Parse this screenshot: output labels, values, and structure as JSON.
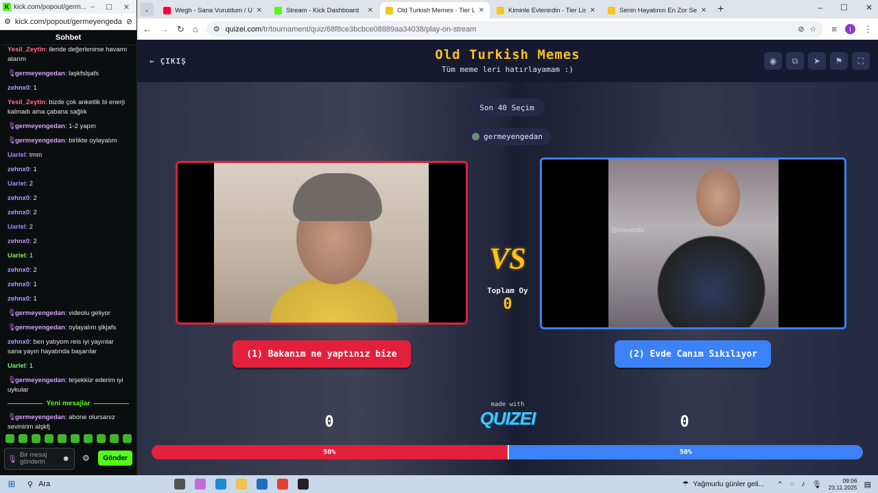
{
  "kick_popout": {
    "window_url_title": "kick.com/popout/germ...",
    "url": "kick.com/popout/germeyengedan...",
    "chat_title": "Sohbet",
    "messages": [
      {
        "user": "Yesil_Zeytin",
        "text": "ileride değerlenirse havamı atarım",
        "color": "yesil",
        "mic": false
      },
      {
        "user": "germeyengedan",
        "text": "laşkfslşafs",
        "color": "germ",
        "mic": true
      },
      {
        "user": "zehnx0",
        "text": "1",
        "color": "zeh",
        "mic": false
      },
      {
        "user": "Yesil_Zeytin",
        "text": "bizde çok anketlik bi enerji kalmadı ama çabana sağlık",
        "color": "yesil",
        "mic": false
      },
      {
        "user": "germeyengedan",
        "text": "1-2 yapın",
        "color": "germ",
        "mic": true
      },
      {
        "user": "germeyengedan",
        "text": "birlikte oylayalım",
        "color": "germ",
        "mic": true
      },
      {
        "user": "Uariel",
        "text": "tmm",
        "color": "uar",
        "mic": false
      },
      {
        "user": "zehnx0",
        "text": "1",
        "color": "zeh",
        "mic": false
      },
      {
        "user": "Uariel",
        "text": "2",
        "color": "uar",
        "mic": false
      },
      {
        "user": "zehnx0",
        "text": "2",
        "color": "zeh",
        "mic": false
      },
      {
        "user": "zehnx0",
        "text": "2",
        "color": "zeh",
        "mic": false
      },
      {
        "user": "Uariel",
        "text": "2",
        "color": "uar",
        "mic": false
      },
      {
        "user": "zehnx0",
        "text": "2",
        "color": "zeh",
        "mic": false
      },
      {
        "user": "Uariel",
        "text": "1",
        "color": "uar2",
        "mic": false
      },
      {
        "user": "zehnx0",
        "text": "2",
        "color": "zeh",
        "mic": false
      },
      {
        "user": "zehnx0",
        "text": "1",
        "color": "zeh",
        "mic": false
      },
      {
        "user": "zehnx0",
        "text": "1",
        "color": "zeh",
        "mic": false
      },
      {
        "user": "germeyengedan",
        "text": "videolu geliyor",
        "color": "germ",
        "mic": true
      },
      {
        "user": "germeyengedan",
        "text": "oylayalım şlkjafs",
        "color": "germ",
        "mic": true
      },
      {
        "user": "zehnx0",
        "text": "ben yatıyom reis iyi yayınlar sana yayın hayatında başarılar",
        "color": "zeh",
        "mic": false
      },
      {
        "user": "Uariel",
        "text": "1",
        "color": "uar2",
        "mic": false
      },
      {
        "user": "germeyengedan",
        "text": "teşekkür ederim iyi uykular",
        "color": "germ",
        "mic": true
      }
    ],
    "new_messages_label": "Yeni mesajlar",
    "after_messages": [
      {
        "user": "germeyengedan",
        "text": "abone olursanız sevinirim alşkfj",
        "color": "germ",
        "mic": true
      }
    ],
    "input_placeholder": "Bir mesaj gönderin",
    "send_label": "Gönder"
  },
  "browser": {
    "tabs": [
      {
        "title": "Wegh - Sana Vuruldum / Ulubatlı",
        "favicon_color": "#ff0033",
        "active": false
      },
      {
        "title": "Stream - Kick Dashboard",
        "favicon_color": "#53fc18",
        "active": false
      },
      {
        "title": "Old Turkish Memes - Tier List",
        "favicon_color": "#f5c518",
        "active": true
      },
      {
        "title": "Kiminle Evlenirdin - Tier List | Kick",
        "favicon_color": "#f5c518",
        "active": false
      },
      {
        "title": "Senin Hayatının En Zor Seçimi",
        "favicon_color": "#f5c518",
        "active": false
      }
    ],
    "url_host": "quizei.com",
    "url_path": "/tr/tournament/quiz/68f8ce3bcbce08889aa34038/play-on-stream",
    "profile_initial": "I"
  },
  "page": {
    "exit_label": "ÇIKIŞ",
    "title": "Old Turkish Memes",
    "subtitle": "Tüm meme leri hatırlayamam :)",
    "round_label": "Son 40 Seçim",
    "streamer": "germeyengedan",
    "left_watermark": "",
    "right_watermark": "@ncsnectlix",
    "vs_label": "VS",
    "total_votes_label": "Toplam Oy",
    "total_votes": "0",
    "option_left": "(1) Bakanım ne yaptınız bize",
    "option_right": "(2) Evde Canım Sıkılıyor",
    "made_with": "made with",
    "brand": "QUIZEI",
    "votes_left": "0",
    "votes_right": "0",
    "percent_left": "50%",
    "percent_right": "50%",
    "split_left_fraction": 0.5,
    "accent_red": "#e3203b",
    "accent_blue": "#3b82f6",
    "accent_gold": "#ffc21a"
  },
  "taskbar": {
    "search_label": "Ara",
    "weather": "Yağmurlu günler geli...",
    "time": "09:06",
    "date": "23.11.2025"
  }
}
